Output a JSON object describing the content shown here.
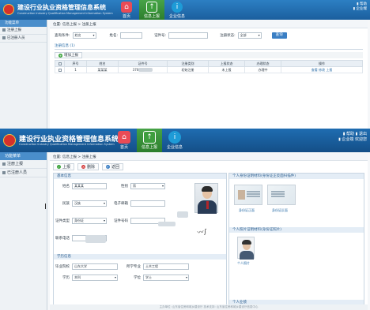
{
  "top": {
    "app_title": "建设行业执业资格管理信息系统",
    "app_subtitle": "Construction Industry Qualification Management Information System",
    "nav": [
      {
        "label": "首页"
      },
      {
        "label": "信息上报"
      },
      {
        "label": "企业信息"
      }
    ],
    "user_line1": "▮ 帮助",
    "user_line2": "▮ 企业端",
    "sidebar_title": "功能菜单",
    "sidebar_items": [
      {
        "label": "注册上报"
      },
      {
        "label": "已注册人员"
      }
    ],
    "breadcrumb": "位置: 信息上报 > 注册上报",
    "search": {
      "label_cond": "查询条件:",
      "cond_value": "姓名",
      "label_name": "姓名:",
      "label_id": "证件号:",
      "label_status": "注册状态:",
      "status_value": "全部",
      "query_label": "查询"
    },
    "section_title": "注册信息 (1)",
    "add_label": "增加上报",
    "table": {
      "headers": [
        "",
        "序号",
        "姓名",
        "证件号",
        "注册类别",
        "上报状态",
        "办理状态",
        "操作"
      ],
      "rows": [
        [
          "",
          "1",
          "某某某",
          "370",
          "初始注册",
          "未上报",
          "办理中",
          "查看  修改  上报"
        ]
      ]
    }
  },
  "bottom": {
    "app_title": "建设行业执业资格管理信息系统",
    "app_subtitle": "Construction Industry Qualification Management Information System",
    "nav": [
      {
        "label": "首页"
      },
      {
        "label": "信息上报"
      },
      {
        "label": "企业信息"
      }
    ],
    "user_line1": "▮ 帮助   ▮ 退出",
    "user_line2": "▮ 企业端   欢迎您",
    "sidebar_title": "功能菜单",
    "sidebar_items": [
      {
        "label": "注册上报"
      },
      {
        "label": "已注册人员"
      }
    ],
    "breadcrumb": "位置: 信息上报 > 注册上报",
    "toolbar": {
      "save": "上报",
      "delete": "删除",
      "back": "返回"
    },
    "form": {
      "section_basic": "基本信息",
      "name_label": "姓名",
      "name_value": "某某某",
      "gender_label": "性别",
      "gender_value": "男",
      "nation_label": "民族",
      "nation_value": "汉族",
      "phone_label": "电子邮箱",
      "idtype_label": "证件类型",
      "idtype_value": "身份证",
      "idno_label": "证件号码",
      "mobile_label": "联系电话",
      "section_edu": "学历信息",
      "school_label": "毕业院校",
      "school_value": "山东大学",
      "major_label": "所学专业",
      "major_value": "土木工程",
      "degree_label": "学历",
      "degree_value": "本科",
      "degree2_label": "学位",
      "degree2_value": "学士"
    },
    "right_panel": {
      "title_id": "个人身份证明材料(身份证正反面扫描件)",
      "card_front_caption": "身份证正面",
      "card_back_caption": "身份证反面",
      "title_photo": "个人照片证明材料(身份证照片)",
      "photo_caption": "个人照片",
      "title_more": "个人业绩"
    },
    "footer": "主办单位: 山东省住房和城乡建设厅   技术支持: 山东省住房和城乡建设厅信息中心"
  },
  "colors": {
    "header": "#1f6db1",
    "active_nav": "#3e9e3e",
    "link": "#2b6ea8"
  }
}
